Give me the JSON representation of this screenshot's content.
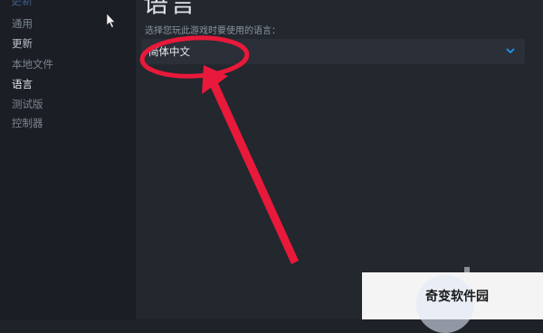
{
  "sidebar": {
    "cut_label": "更新",
    "items": [
      {
        "label": "通用"
      },
      {
        "label": "更新"
      },
      {
        "label": "本地文件"
      },
      {
        "label": "语言"
      },
      {
        "label": "测试版"
      },
      {
        "label": "控制器"
      }
    ],
    "active_index": 3
  },
  "main": {
    "heading": "语言",
    "prompt": "选择您玩此游戏时要使用的语言：",
    "language_select": {
      "value": "简体中文"
    }
  },
  "annotation": {
    "color": "#e8193a"
  },
  "watermark": {
    "text": "奇变软件园"
  },
  "colors": {
    "accent": "#1a9fff",
    "annotation_red": "#e8193a"
  }
}
